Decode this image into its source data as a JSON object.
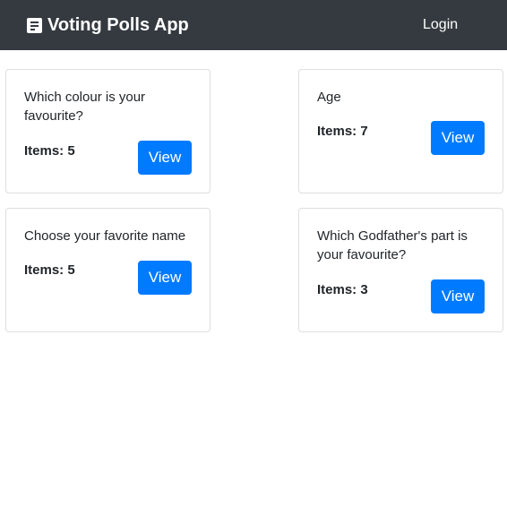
{
  "app": {
    "title": "Voting Polls App",
    "icon": "poll-icon"
  },
  "nav": {
    "login_label": "Login"
  },
  "colors": {
    "navbar": "#343a40",
    "primary": "#007bff"
  },
  "polls": [
    {
      "question": "Which colour is your favourite?",
      "items_label": "Items: 5",
      "view_label": "View"
    },
    {
      "question": "Age",
      "items_label": "Items: 7",
      "view_label": "View"
    },
    {
      "question": "Choose your favorite name",
      "items_label": "Items: 5",
      "view_label": "View"
    },
    {
      "question": "Which Godfather's part is your favourite?",
      "items_label": "Items: 3",
      "view_label": "View"
    }
  ]
}
